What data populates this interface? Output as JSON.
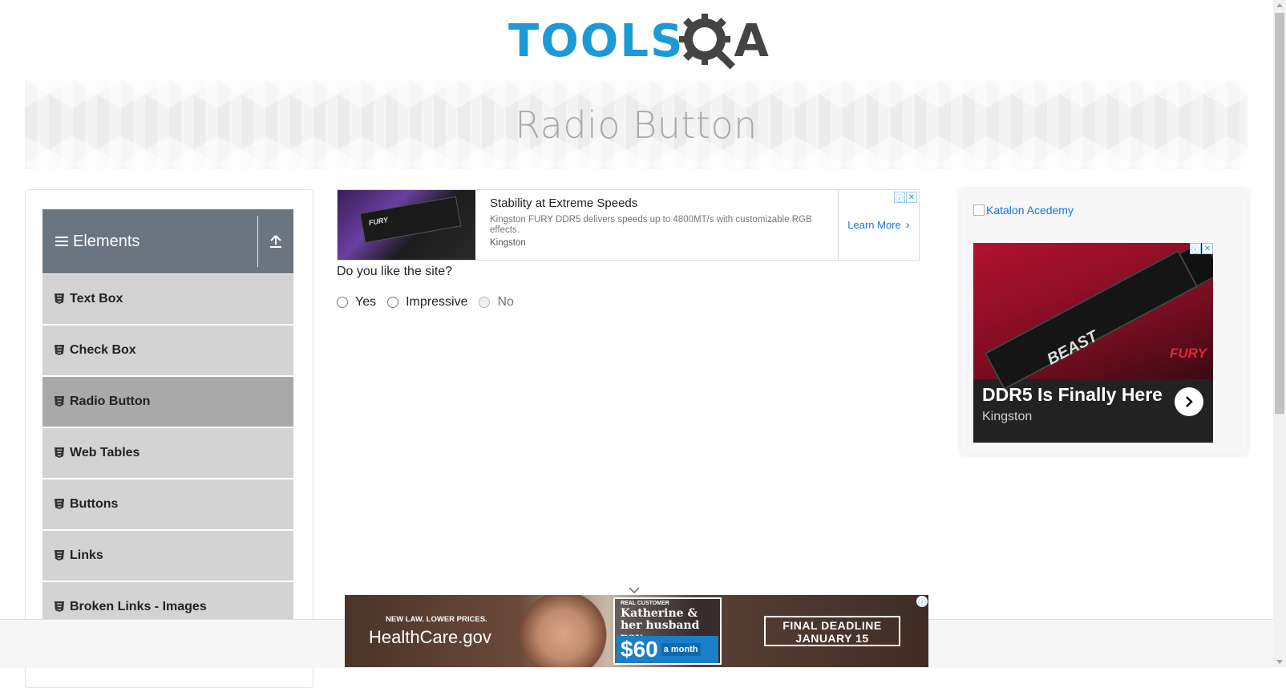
{
  "logo": {
    "tools_text": "TOOLS",
    "qa_text": "A"
  },
  "banner": {
    "title": "Radio Button"
  },
  "sidebar": {
    "group_title": "Elements",
    "items": [
      {
        "label": "Text Box"
      },
      {
        "label": "Check Box"
      },
      {
        "label": "Radio Button",
        "active": true
      },
      {
        "label": "Web Tables"
      },
      {
        "label": "Buttons"
      },
      {
        "label": "Links"
      },
      {
        "label": "Broken Links - Images"
      }
    ]
  },
  "top_ad": {
    "title": "Stability at Extreme Speeds",
    "description": "Kingston FURY DDR5 delivers speeds up to 4800MT/s with customizable RGB effects.",
    "brand": "Kingston",
    "cta": "Learn More",
    "image_text": "FURY"
  },
  "question": {
    "text": "Do you like the site?"
  },
  "radio_options": [
    {
      "label": "Yes",
      "disabled": false
    },
    {
      "label": "Impressive",
      "disabled": false
    },
    {
      "label": "No",
      "disabled": true
    }
  ],
  "right_panel": {
    "katalon_alt": "Katalon Acedemy",
    "ad": {
      "headline": "DDR5 Is Finally Here",
      "brand": "Kingston",
      "ram_label": "BEAST",
      "fury_label": "FURY"
    }
  },
  "bottom_ad": {
    "tagline": "NEW LAW. LOWER PRICES.",
    "brand": "HealthCare.gov",
    "quote_tag": "REAL CUSTOMER",
    "quote_name": "Katherine & her husband pay",
    "price": "$60",
    "per": "a month",
    "deadline_line1": "FINAL DEADLINE",
    "deadline_line2": "JANUARY 15"
  },
  "colors": {
    "logo_blue": "#1b9ad6",
    "group_header_bg": "#6b7580",
    "menu_item_bg": "#d3d3d3",
    "menu_item_active_bg": "#a9a9a9",
    "link_blue": "#1a73e8"
  }
}
